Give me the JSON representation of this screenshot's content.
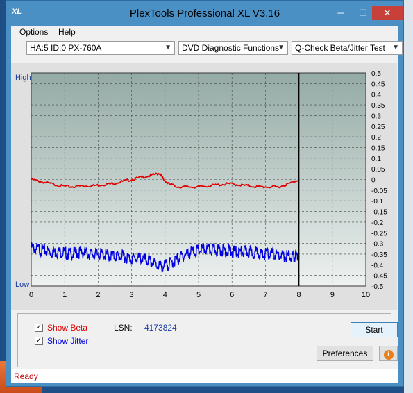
{
  "window": {
    "title": "PlexTools Professional XL V3.16",
    "app_icon_text": "XL",
    "minimize_glyph": "─",
    "maximize_glyph": "☐",
    "close_glyph": "✕"
  },
  "menu": {
    "options_label": "Options",
    "help_label": "Help"
  },
  "toolbar": {
    "drive_select": "HA:5 ID:0  PX-760A",
    "function_select": "DVD Diagnostic Functions",
    "test_select": "Q-Check Beta/Jitter Test"
  },
  "chart_data": {
    "type": "line",
    "left_axis_top_label": "High",
    "left_axis_bottom_label": "Low",
    "x_ticks": [
      "0",
      "1",
      "2",
      "3",
      "4",
      "5",
      "6",
      "7",
      "8",
      "9",
      "10"
    ],
    "xlim": [
      0,
      10
    ],
    "y_right_ticks": [
      "0.5",
      "0.45",
      "0.4",
      "0.35",
      "0.3",
      "0.25",
      "0.2",
      "0.15",
      "0.1",
      "0.05",
      "0",
      "-0.05",
      "-0.1",
      "-0.15",
      "-0.2",
      "-0.25",
      "-0.3",
      "-0.35",
      "-0.4",
      "-0.45",
      "-0.5"
    ],
    "ylim": [
      -0.5,
      0.5
    ],
    "grid": true,
    "cursor_x": 8.0,
    "series": [
      {
        "name": "Beta",
        "color": "#e00000",
        "x": [
          0,
          0.3,
          0.6,
          0.9,
          1.2,
          1.5,
          1.8,
          2.1,
          2.4,
          2.7,
          3.0,
          3.3,
          3.6,
          3.85,
          3.95,
          4.1,
          4.4,
          4.7,
          5.0,
          5.3,
          5.6,
          5.9,
          6.2,
          6.5,
          6.8,
          7.1,
          7.4,
          7.7,
          8.0
        ],
        "values": [
          0.0,
          -0.01,
          -0.02,
          -0.03,
          -0.035,
          -0.03,
          -0.03,
          -0.025,
          -0.02,
          -0.01,
          0.0,
          0.01,
          0.02,
          0.03,
          0.0,
          -0.02,
          -0.035,
          -0.035,
          -0.035,
          -0.03,
          -0.025,
          -0.02,
          -0.025,
          -0.03,
          -0.035,
          -0.035,
          -0.035,
          -0.02,
          0.0
        ]
      },
      {
        "name": "Jitter",
        "color": "#0000e0",
        "x": [
          0,
          0.3,
          0.6,
          0.9,
          1.2,
          1.5,
          1.8,
          2.1,
          2.4,
          2.7,
          3.0,
          3.3,
          3.6,
          3.9,
          4.2,
          4.5,
          4.8,
          5.1,
          5.4,
          5.7,
          6.0,
          6.3,
          6.6,
          6.9,
          7.2,
          7.5,
          7.8,
          8.0
        ],
        "values": [
          -0.32,
          -0.33,
          -0.34,
          -0.34,
          -0.35,
          -0.34,
          -0.35,
          -0.35,
          -0.36,
          -0.36,
          -0.37,
          -0.37,
          -0.39,
          -0.41,
          -0.39,
          -0.36,
          -0.34,
          -0.33,
          -0.33,
          -0.33,
          -0.34,
          -0.34,
          -0.34,
          -0.35,
          -0.35,
          -0.36,
          -0.36,
          -0.36
        ]
      }
    ]
  },
  "controls": {
    "show_beta_label": "Show Beta",
    "show_beta_checked": true,
    "show_jitter_label": "Show Jitter",
    "show_jitter_checked": true,
    "lsn_label": "LSN:",
    "lsn_value": "4173824",
    "start_label": "Start",
    "preferences_label": "Preferences",
    "info_glyph": "i",
    "check_glyph": "✓"
  },
  "status": {
    "text": "Ready"
  },
  "colors": {
    "beta": "#e00000",
    "jitter": "#0000e0",
    "status_text": "#c00000",
    "axis_label": "#1a3aa0"
  }
}
